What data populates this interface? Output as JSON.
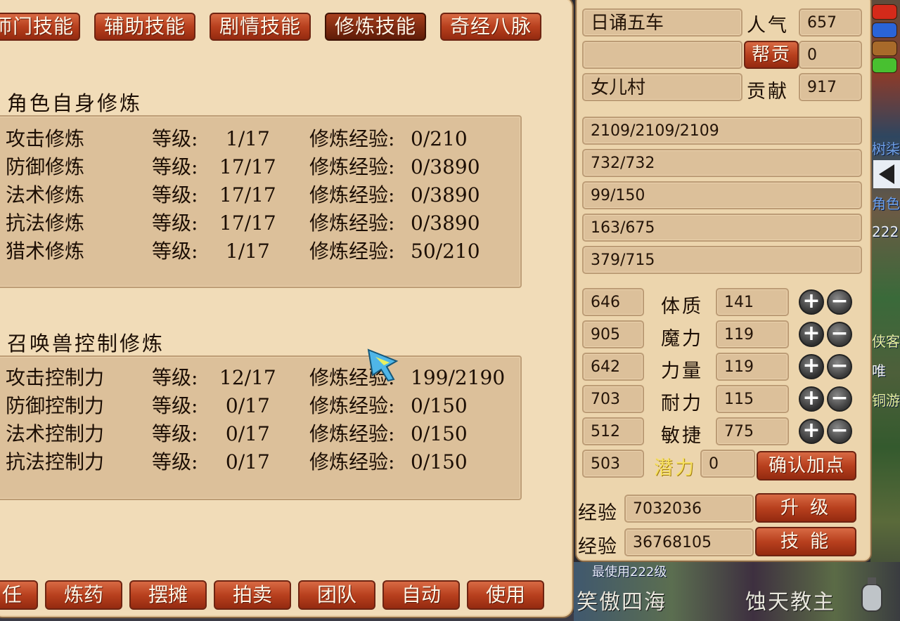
{
  "tabs": [
    {
      "label": "师门技能",
      "active": false
    },
    {
      "label": "辅助技能",
      "active": false
    },
    {
      "label": "剧情技能",
      "active": false
    },
    {
      "label": "修炼技能",
      "active": true
    },
    {
      "label": "奇经八脉",
      "active": false
    }
  ],
  "self_cultivation": {
    "title": "角色自身修炼",
    "rows": [
      {
        "name": "攻击修炼",
        "level_label": "等级:",
        "level": " 1/17",
        "exp_label": "修炼经验:",
        "exp": "0/210"
      },
      {
        "name": "防御修炼",
        "level_label": "等级:",
        "level": "17/17",
        "exp_label": "修炼经验:",
        "exp": "0/3890"
      },
      {
        "name": "法术修炼",
        "level_label": "等级:",
        "level": "17/17",
        "exp_label": "修炼经验:",
        "exp": "0/3890"
      },
      {
        "name": "抗法修炼",
        "level_label": "等级:",
        "level": "17/17",
        "exp_label": "修炼经验:",
        "exp": "0/3890"
      },
      {
        "name": "猎术修炼",
        "level_label": "等级:",
        "level": " 1/17",
        "exp_label": "修炼经验:",
        "exp": "50/210"
      }
    ]
  },
  "pet_cultivation": {
    "title": "召唤兽控制修炼",
    "rows": [
      {
        "name": "攻击控制力",
        "level_label": "等级:",
        "level": "12/17",
        "exp_label": "修炼经验:",
        "exp": "199/2190"
      },
      {
        "name": "防御控制力",
        "level_label": "等级:",
        "level": " 0/17",
        "exp_label": "修炼经验:",
        "exp": "0/150"
      },
      {
        "name": "法术控制力",
        "level_label": "等级:",
        "level": " 0/17",
        "exp_label": "修炼经验:",
        "exp": "0/150"
      },
      {
        "name": "抗法控制力",
        "level_label": "等级:",
        "level": " 0/17",
        "exp_label": "修炼经验:",
        "exp": "0/150"
      }
    ]
  },
  "bottom_buttons": [
    "任",
    "炼药",
    "摆摊",
    "拍卖",
    "团队",
    "自动",
    "使用"
  ],
  "char": {
    "title_value": "日诵五车",
    "popularity_label": "人气",
    "popularity": "657",
    "gang_field": "",
    "gang_button": "帮贡",
    "gang_points": "0",
    "sect": "女儿村",
    "contribution_label": "贡献",
    "contribution": "917",
    "bars": [
      "2109/2109/2109",
      "732/732",
      "99/150",
      "163/675",
      "379/715"
    ],
    "stats": [
      {
        "derived": "646",
        "label": "体质",
        "value": "141"
      },
      {
        "derived": "905",
        "label": "魔力",
        "value": "119"
      },
      {
        "derived": "642",
        "label": "力量",
        "value": "119"
      },
      {
        "derived": "703",
        "label": "耐力",
        "value": "115"
      },
      {
        "derived": "512",
        "label": "敏捷",
        "value": "775"
      }
    ],
    "potential_derived": "503",
    "potential_label": "潜力",
    "potential": "0",
    "confirm_button": "确认加点",
    "exp_label": "经验",
    "exp1": "7032036",
    "upgrade_button": "升 级",
    "exp2": "36768105",
    "skill_button": "技 能"
  },
  "world": {
    "bottom_text_1": "笑傲四海",
    "bottom_text_2": "蚀天教主",
    "name_plate": "最使用222级",
    "side_labels": [
      "树柒",
      "角色",
      "222",
      "侠客",
      "唯",
      "铜游"
    ]
  },
  "colors": {
    "panel_bg": "#f1dcb8",
    "button_red": "#b8401e",
    "field_bg": "#dcc09a",
    "potential_gold": "#f6e060"
  }
}
